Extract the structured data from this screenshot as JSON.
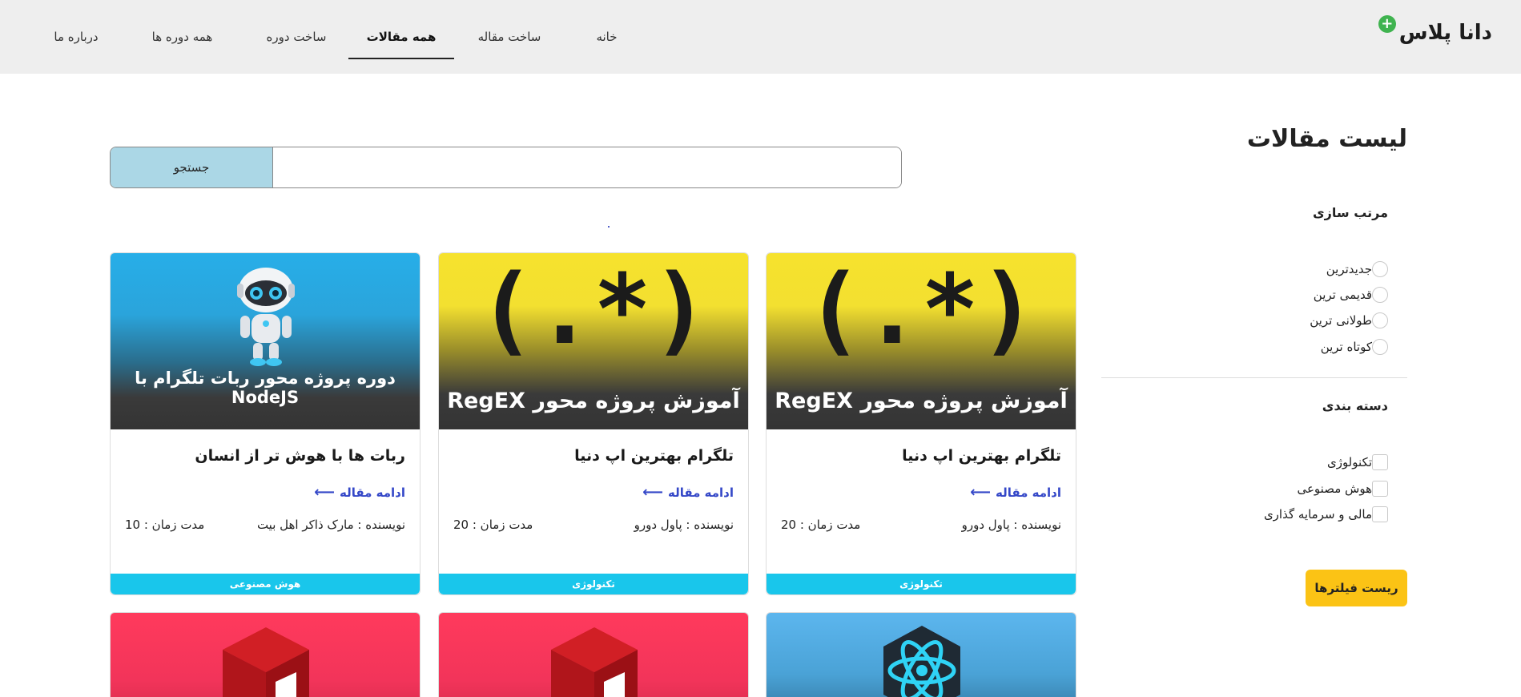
{
  "header": {
    "logo": "دانا پلاس",
    "logo_plus": "+",
    "nav": [
      "خانه",
      "ساخت مقاله",
      "همه مقالات",
      "ساخت دوره",
      "همه دوره ها",
      "درباره ما"
    ],
    "active_nav": "همه مقالات"
  },
  "sidebar": {
    "title": "لیست مقالات",
    "sort_title": "مرتب سازی",
    "sort_options": [
      "جدیدترین",
      "قدیمی ترین",
      "طولانی ترین",
      "کوتاه ترین"
    ],
    "category_title": "دسته بندی",
    "categories": [
      "تکنولوژی",
      "هوش مصنوعی",
      "مالی و سرمایه گذاری"
    ],
    "reset_label": "ریست فیلترها"
  },
  "search": {
    "button_label": "جستجو",
    "value": "",
    "placeholder": ""
  },
  "cards": [
    {
      "image_text": "آموزش پروژه محور RegEX",
      "image_symbol": "(.*)",
      "title": "تلگرام بهترین اپ دنیا",
      "read_more": "ادامه مقاله",
      "author": "نویسنده : پاول دورو",
      "duration": "مدت زمان : 20",
      "tag": "تکنولوژی"
    },
    {
      "image_text": "آموزش پروژه محور RegEX",
      "image_symbol": "(.*)",
      "title": "تلگرام بهترین اپ دنیا",
      "read_more": "ادامه مقاله",
      "author": "نویسنده : پاول دورو",
      "duration": "مدت زمان : 20",
      "tag": "تکنولوژی"
    },
    {
      "image_text": "دوره پروژه محور ربات تلگرام با NodeJS",
      "title": "ربات ها با هوش تر از انسان",
      "read_more": "ادامه مقاله",
      "author": "نویسنده : مارک ذاکر اهل بیت",
      "duration": "مدت زمان : 10",
      "tag": "هوش مصنوعی"
    }
  ],
  "icons": {
    "arrow": "arrow-left-icon",
    "logo_badge": "plus-circle-icon"
  },
  "colors": {
    "header_bg": "#eeeeee",
    "reset_button": "#fbc315",
    "tag_bg": "#19c6eb",
    "link": "#3548c8",
    "search_button": "#abd7e6"
  }
}
